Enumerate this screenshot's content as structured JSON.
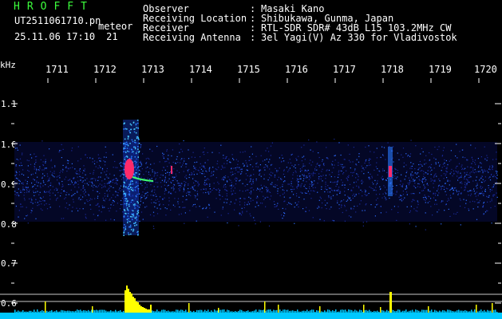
{
  "header": {
    "app_title": "HROFFT",
    "file_name": "UT2511061710.pn",
    "file_type": "meteor",
    "date_time": "25.11.06 17:10",
    "date_extra": "21",
    "info": [
      {
        "label": "Observer",
        "value": "Masaki Kano"
      },
      {
        "label": "Receiving Location",
        "value": "Shibukawa, Gunma, Japan"
      },
      {
        "label": "Receiver",
        "value": "RTL-SDR SDR# 43dB L15 103.2MHz CW"
      },
      {
        "label": "Receiving Antenna",
        "value": "3el Yagi(V) Az 330 for Vladivostok"
      }
    ]
  },
  "axis": {
    "freq_unit": "kHz",
    "y_ticks": [
      "1.1",
      "1.0",
      "0.9",
      "0.8",
      "0.7",
      "0.6"
    ],
    "time_ticks": [
      "1711",
      "1712",
      "1713",
      "1714",
      "1715",
      "1716",
      "1717",
      "1718",
      "1719",
      "1720"
    ]
  },
  "colors": {
    "background": "#000000",
    "title": "#3cff3c",
    "noise_dark": "#1a2a9a",
    "noise_light": "#2e6cff",
    "echo": "#ff2a6a",
    "signal_bar": "#ffff00",
    "baseline": "#00c8ff",
    "tick": "#ffffff"
  }
}
